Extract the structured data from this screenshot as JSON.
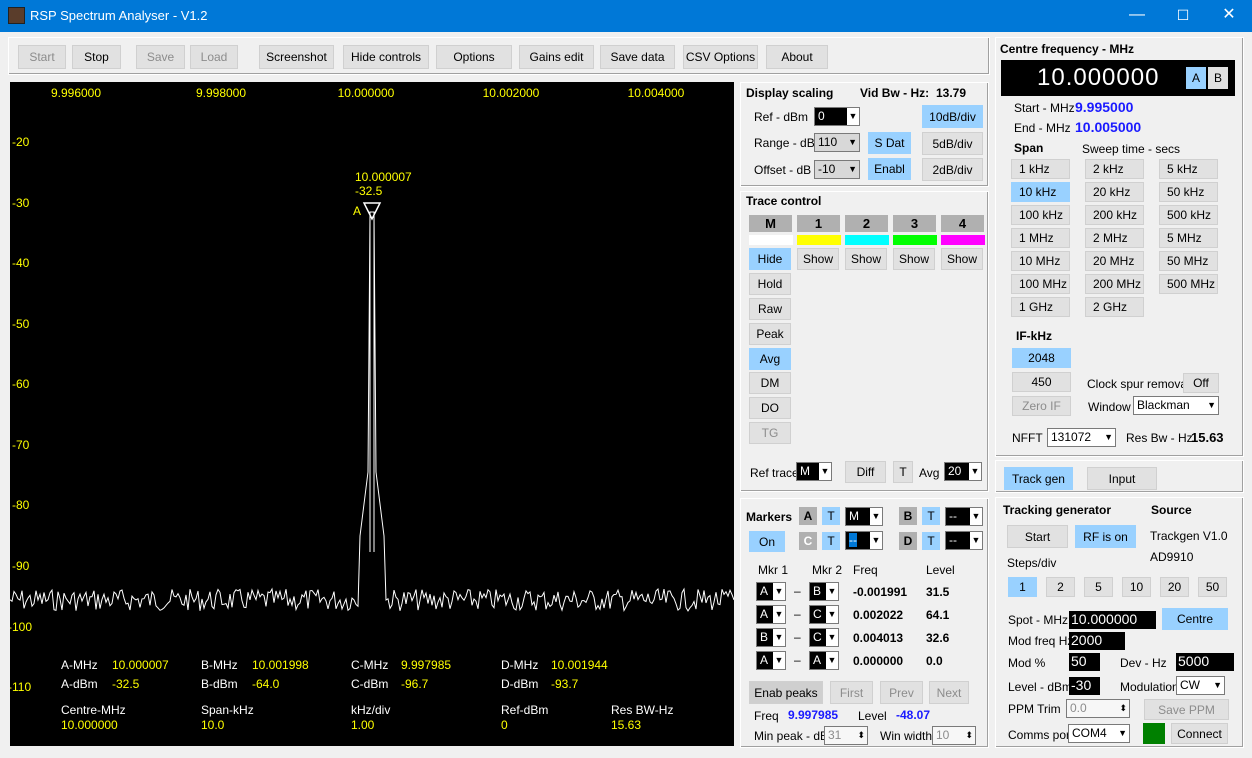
{
  "window": {
    "title": "RSP Spectrum Analyser - V1.2",
    "minimize": "—",
    "maximize": "☐",
    "close": "✕"
  },
  "toolbar": {
    "start": "Start",
    "stop": "Stop",
    "save": "Save",
    "load": "Load",
    "screenshot": "Screenshot",
    "hide_controls": "Hide controls",
    "options": "Options",
    "gains_edit": "Gains edit",
    "save_data": "Save data",
    "csv_options": "CSV Options",
    "about": "About"
  },
  "plot": {
    "x_ticks": [
      "9.996000",
      "9.998000",
      "10.000000",
      "10.002000",
      "10.004000"
    ],
    "y_ticks": [
      "-20",
      "-30",
      "-40",
      "-50",
      "-60",
      "-70",
      "-80",
      "-90",
      "-100",
      "-110"
    ],
    "marker_freq": "10.000007",
    "marker_level": "-32.5",
    "marker_letter": "A",
    "readout": {
      "a_mhz_label": "A-MHz",
      "a_mhz": "10.000007",
      "b_mhz_label": "B-MHz",
      "b_mhz": "10.001998",
      "c_mhz_label": "C-MHz",
      "c_mhz": "9.997985",
      "d_mhz_label": "D-MHz",
      "d_mhz": "10.001944",
      "a_dbm_label": "A-dBm",
      "a_dbm": "-32.5",
      "b_dbm_label": "B-dBm",
      "b_dbm": "-64.0",
      "c_dbm_label": "C-dBm",
      "c_dbm": "-96.7",
      "d_dbm_label": "D-dBm",
      "d_dbm": "-93.7",
      "centre_label": "Centre-MHz",
      "centre": "10.000000",
      "span_label": "Span-kHz",
      "span": "10.0",
      "khzdiv_label": "kHz/div",
      "khzdiv": "1.00",
      "ref_label": "Ref-dBm",
      "ref": "0",
      "resbw_label": "Res BW-Hz",
      "resbw": "15.63"
    }
  },
  "display_scaling": {
    "title": "Display scaling",
    "vid_bw_label": "Vid Bw - Hz:",
    "vid_bw": "13.79",
    "ref_label": "Ref - dBm",
    "ref": "0",
    "range_label": "Range - dB",
    "range": "110",
    "offset_label": "Offset - dB",
    "offset": "-10",
    "sdat": "S Dat",
    "enabl": "Enabl",
    "d10": "10dB/div",
    "d5": "5dB/div",
    "d2": "2dB/div"
  },
  "trace": {
    "title": "Trace control",
    "tabs": [
      "M",
      "1",
      "2",
      "3",
      "4"
    ],
    "colors": [
      "#ffffff",
      "#ffff00",
      "#00ffff",
      "#00ff00",
      "#ff00ff"
    ],
    "hide": "Hide",
    "show": "Show",
    "hold": "Hold",
    "raw": "Raw",
    "peak": "Peak",
    "avg": "Avg",
    "dm": "DM",
    "do": "DO",
    "tg": "TG",
    "ref_trace_label": "Ref trace",
    "ref_trace": "M",
    "diff": "Diff",
    "t": "T",
    "avg_label": "Avg",
    "avg_val": "20"
  },
  "markers": {
    "title": "Markers",
    "on": "On",
    "a": "A",
    "b": "B",
    "c": "C",
    "d": "D",
    "t": "T",
    "m_sel": "M",
    "dash": "--",
    "mkr1": "Mkr 1",
    "mkr2": "Mkr 2",
    "freq_h": "Freq",
    "level_h": "Level",
    "rows": [
      {
        "m1": "A",
        "m2": "B",
        "freq": "-0.001991",
        "level": "31.5"
      },
      {
        "m1": "A",
        "m2": "C",
        "freq": "0.002022",
        "level": "64.1"
      },
      {
        "m1": "B",
        "m2": "C",
        "freq": "0.004013",
        "level": "32.6"
      },
      {
        "m1": "A",
        "m2": "A",
        "freq": "0.000000",
        "level": "0.0"
      }
    ],
    "enab_peaks": "Enab peaks",
    "first": "First",
    "prev": "Prev",
    "next": "Next",
    "freq_label": "Freq",
    "freq": "9.997985",
    "level_label": "Level",
    "level": "-48.07",
    "min_peak_label": "Min peak - dB",
    "min_peak": "31",
    "win_width_label": "Win width",
    "win_width": "10"
  },
  "centre": {
    "title": "Centre frequency - MHz",
    "value": "10.000000",
    "a": "A",
    "b": "B",
    "start_label": "Start - MHz",
    "start": "9.995000",
    "end_label": "End - MHz",
    "end": "10.005000",
    "span_label": "Span",
    "sweep_label": "Sweep time - secs",
    "spans": [
      "1 kHz",
      "2 kHz",
      "5 kHz",
      "10 kHz",
      "20 kHz",
      "50 kHz",
      "100 kHz",
      "200 kHz",
      "500 kHz",
      "1 MHz",
      "2 MHz",
      "5 MHz",
      "10 MHz",
      "20 MHz",
      "50 MHz",
      "100 MHz",
      "200 MHz",
      "500 MHz",
      "1 GHz",
      "2 GHz"
    ],
    "if_label": "IF-kHz",
    "if1": "2048",
    "if2": "450",
    "zero_if": "Zero IF",
    "clock_label": "Clock spur removal",
    "clock": "Off",
    "window_label": "Window",
    "window": "Blackman",
    "nfft_label": "NFFT",
    "nfft": "131072",
    "resbw_label": "Res Bw - Hz",
    "resbw": "15.63"
  },
  "tabs2": {
    "track_gen": "Track gen",
    "input": "Input"
  },
  "tg": {
    "title": "Tracking generator",
    "source_label": "Source",
    "start": "Start",
    "rf_on": "RF is on",
    "source1": "Trackgen V1.0",
    "source2": "AD9910",
    "steps_label": "Steps/div",
    "steps": [
      "1",
      "2",
      "5",
      "10",
      "20",
      "50"
    ],
    "spot_label": "Spot - MHz",
    "spot": "10.000000",
    "centre": "Centre",
    "modfreq_label": "Mod freq Hz",
    "modfreq": "2000",
    "modpct_label": "Mod %",
    "modpct": "50",
    "dev_label": "Dev - Hz",
    "dev": "5000",
    "level_label": "Level - dBm",
    "level": "-30",
    "modulation_label": "Modulation",
    "modulation": "CW",
    "ppm_label": "PPM Trim",
    "ppm": "0.0",
    "save_ppm": "Save PPM",
    "comms_label": "Comms port",
    "comms": "COM4",
    "connect": "Connect"
  }
}
